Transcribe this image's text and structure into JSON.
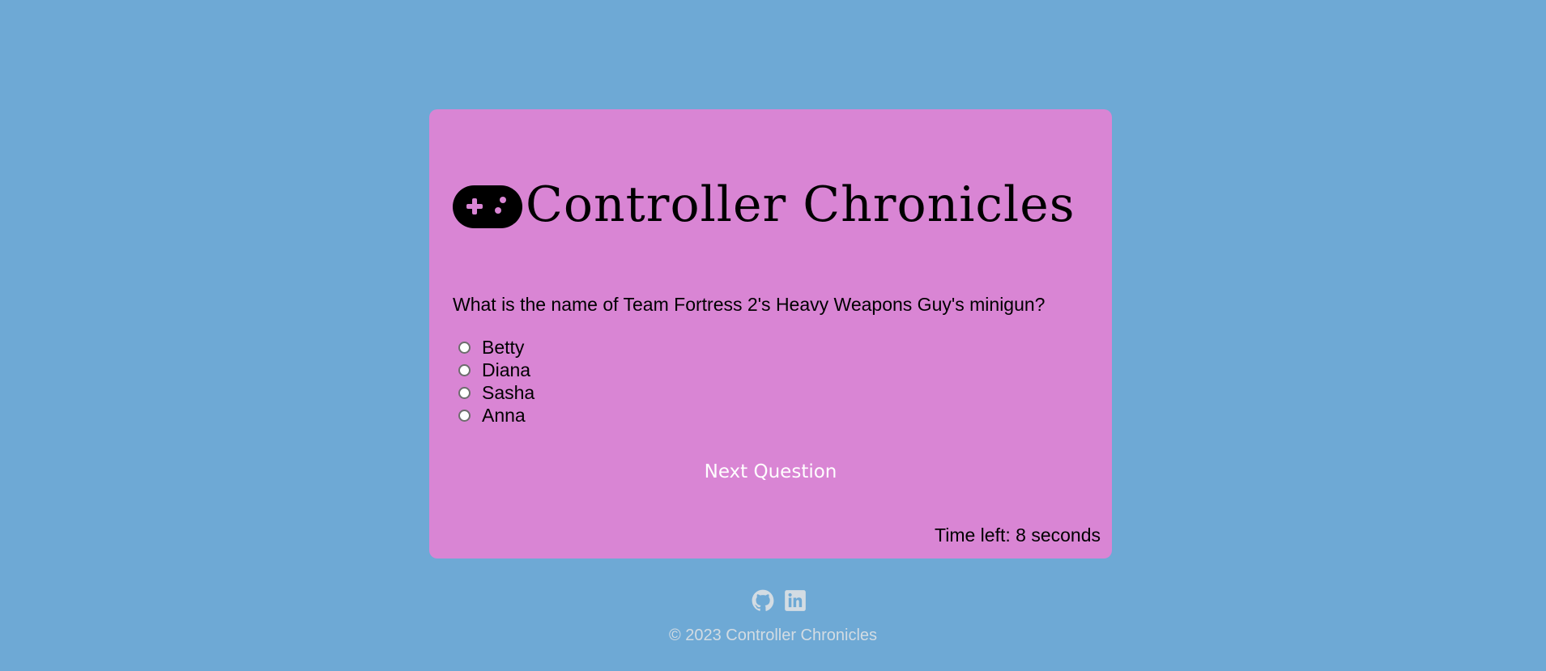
{
  "app": {
    "title": "Controller Chronicles"
  },
  "quiz": {
    "question": "What is the name of Team Fortress 2's Heavy Weapons Guy's minigun?",
    "answers": [
      {
        "label": "Betty"
      },
      {
        "label": "Diana"
      },
      {
        "label": "Sasha"
      },
      {
        "label": "Anna"
      }
    ],
    "next_label": "Next Question",
    "timer_prefix": "Time left: ",
    "timer_value": "8",
    "timer_suffix": " seconds"
  },
  "footer": {
    "icons": [
      "github-icon",
      "linkedin-icon"
    ],
    "copyright": "© 2023 Controller Chronicles"
  },
  "colors": {
    "background": "#6ea9d5",
    "card": "#d985d4",
    "button_text": "#ffffff",
    "footer_text": "#d3dce3"
  }
}
